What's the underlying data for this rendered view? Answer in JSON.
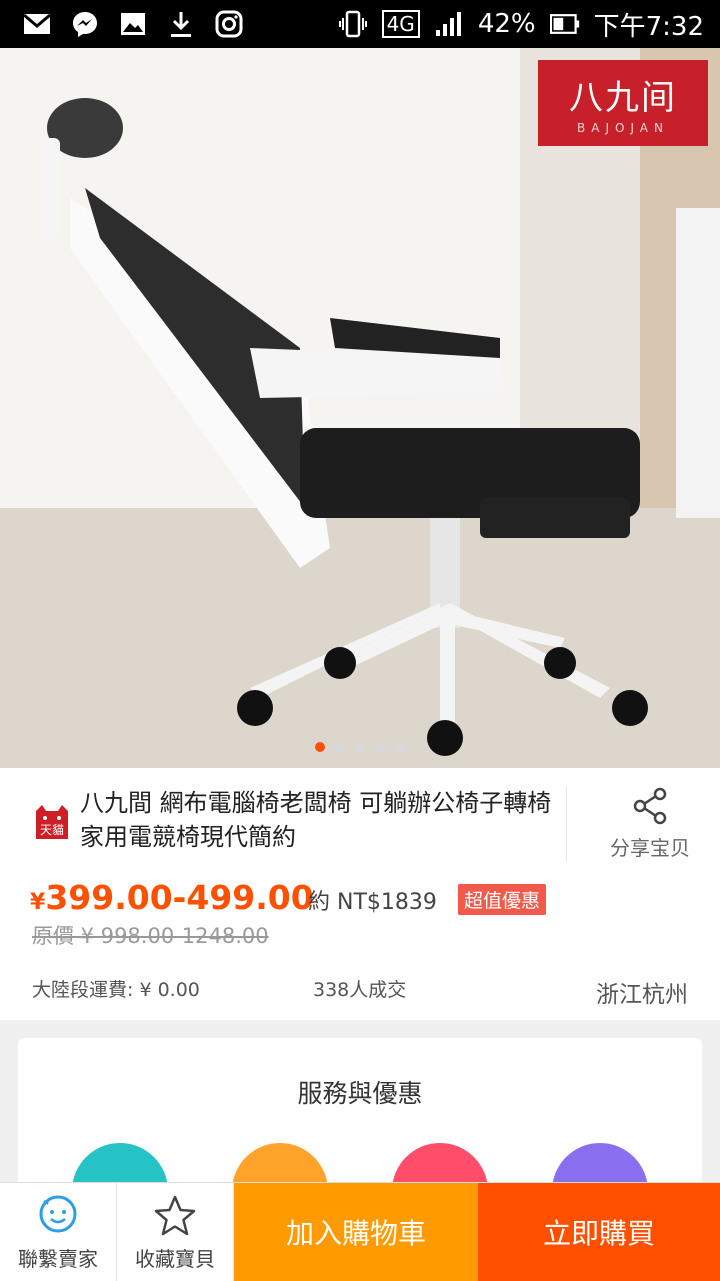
{
  "status_bar": {
    "battery": "42%",
    "network": "4G",
    "time": "下午7:32"
  },
  "hero": {
    "brand_logo_cn": "八九间",
    "brand_logo_en": "BAJOJAN",
    "carousel_total": 5,
    "carousel_active": 1
  },
  "product": {
    "badge": "天貓",
    "title": "八九間 網布電腦椅老闆椅 可躺辦公椅子轉椅 家用電競椅現代簡約",
    "share_label": "分享宝贝",
    "price_symbol": "¥",
    "price_range": "399.00-499.00",
    "approx_price": "約 NT$1839",
    "promo_badge": "超值優惠",
    "original_price": "原價 ¥ 998.00-1248.00",
    "shipping": "大陸段運費: ¥ 0.00",
    "sold": "338人成交",
    "location": "浙江杭州"
  },
  "services": {
    "title": "服務與優惠"
  },
  "bottom_bar": {
    "contact_label": "聯繫賣家",
    "favorite_label": "收藏寶貝",
    "add_to_cart": "加入購物車",
    "buy_now": "立即購買"
  },
  "colors": {
    "accent": "#ff5000",
    "cart": "#ff9a00",
    "promo": "#f15a4a"
  }
}
